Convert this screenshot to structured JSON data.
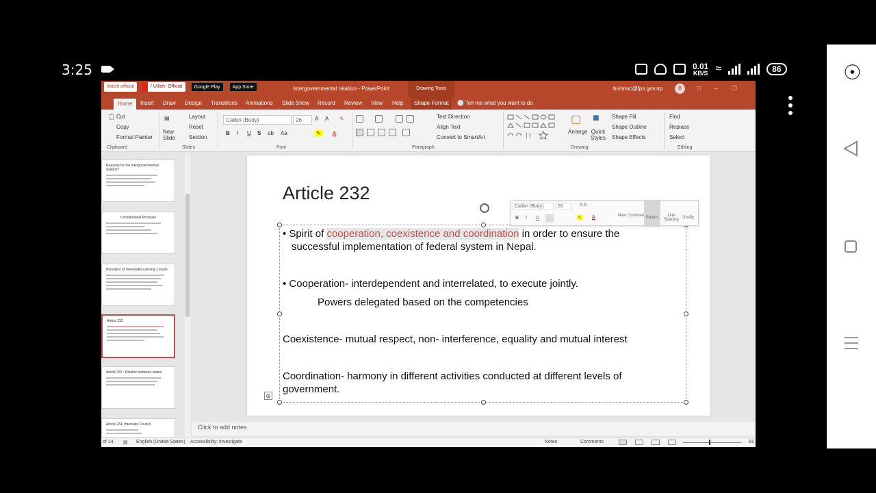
{
  "status": {
    "time": "3:25",
    "speed_value": "0.01",
    "speed_unit": "KB/S",
    "battery": "86"
  },
  "titlebar": {
    "links": [
      "/lotish.official",
      "/ Ullish- Official",
      "Google Play",
      "App Store"
    ],
    "doc_name": "Intergovernmental relation - PowerPoint",
    "drawing_tools": "Drawing Tools",
    "user": "bishnuc@fps.gov.np",
    "avatar": "B"
  },
  "tabs": [
    "Home",
    "Insert",
    "Draw",
    "Design",
    "Transitions",
    "Animations",
    "Slide Show",
    "Record",
    "Review",
    "View",
    "Help",
    "Shape Format"
  ],
  "tell_me": "Tell me what you want to do",
  "ribbon": {
    "clipboard": {
      "cut": "Cut",
      "copy": "Copy",
      "format_painter": "Format Painter",
      "label": "Clipboard"
    },
    "slides": {
      "new_slide": "New Slide",
      "layout": "Layout",
      "reset": "Reset",
      "section": "Section",
      "label": "Slides"
    },
    "font": {
      "name": "Calibri (Body)",
      "size": "26",
      "label": "Font"
    },
    "paragraph": {
      "text_direction": "Text Direction",
      "align_text": "Align Text",
      "smartart": "Convert to SmartArt",
      "label": "Paragraph"
    },
    "drawing": {
      "arrange": "Arrange",
      "quick_styles": "Quick Styles",
      "shape_fill": "Shape Fill",
      "shape_outline": "Shape Outline",
      "shape_effects": "Shape Effects",
      "label": "Drawing"
    },
    "editing": {
      "find": "Find",
      "replace": "Replace",
      "select": "Select",
      "label": "Editing"
    }
  },
  "thumbnails": [
    {
      "title": "Reasons for the intergovernmental relation?"
    },
    {
      "title": "Constitutional Provision"
    },
    {
      "title": "Principles of interrelation among 3 levels"
    },
    {
      "title": "Article 232"
    },
    {
      "title": "Article 233 : Relation between states"
    },
    {
      "title": "Article 234: Interstate Council"
    }
  ],
  "slide": {
    "title": "Article 232",
    "bullet1_pre": "Spirit of ",
    "bullet1_hl": "cooperation, coexistence and coordination",
    "bullet1_post": " in order to ensure the",
    "bullet1_line2": "successful implementation of federal system in Nepal.",
    "bullet2": "Cooperation- interdependent and interrelated, to execute jointly.",
    "sub2": "Powers delegated based on the competencies",
    "para3": "Coexistence- mutual respect, non- interference, equality and mutual interest",
    "para4_line1": "Coordination- harmony in different activities conducted at different levels of",
    "para4_line2": "government."
  },
  "minibar": {
    "font": "Calibri (Body)",
    "size": "26",
    "new_comment": "New Comment",
    "bullets": "Bullets",
    "line_spacing": "Line Spacing",
    "justify": "Justify"
  },
  "notes_placeholder": "Click to add notes",
  "statusbar": {
    "slide": "of 14",
    "language": "English (United States)",
    "accessibility": "Accessibility: Investigate",
    "notes": "Notes",
    "comments": "Comments",
    "zoom": "81"
  }
}
